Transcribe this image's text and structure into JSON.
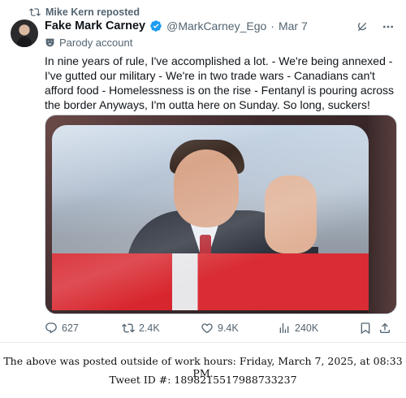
{
  "repost": {
    "text": "Mike Kern reposted"
  },
  "tweet": {
    "display_name": "Fake Mark Carney",
    "handle": "@MarkCarney_Ego",
    "separator": "·",
    "date": "Mar 7",
    "label": "Parody account",
    "text": "In nine years of rule, I've accomplished a lot. - We're being annexed - I've gutted our military - We're in two trade wars - Canadians can't afford food - Homelessness is on the rise - Fentanyl is pouring across the border Anyways, I'm outta here on Sunday. So long, suckers!"
  },
  "actions": {
    "replies": "627",
    "reposts": "2.4K",
    "likes": "9.4K",
    "views": "240K"
  },
  "icons": {
    "repost": "repost-icon",
    "verified": "verified-badge-icon",
    "grok": "grok-icon",
    "more": "more-icon",
    "parody": "parody-mask-icon",
    "reply": "reply-icon",
    "like": "heart-icon",
    "views": "views-chart-icon",
    "bookmark": "bookmark-icon",
    "share": "share-icon"
  },
  "colors": {
    "verified": "#1d9bf0",
    "muted": "#536471",
    "text": "#0f1419"
  },
  "footer": {
    "line1": "The above was posted outside of work hours: Friday, March 7, 2025, at 08:33 PM.",
    "line2": "Tweet ID #: 1898215517988733237"
  }
}
